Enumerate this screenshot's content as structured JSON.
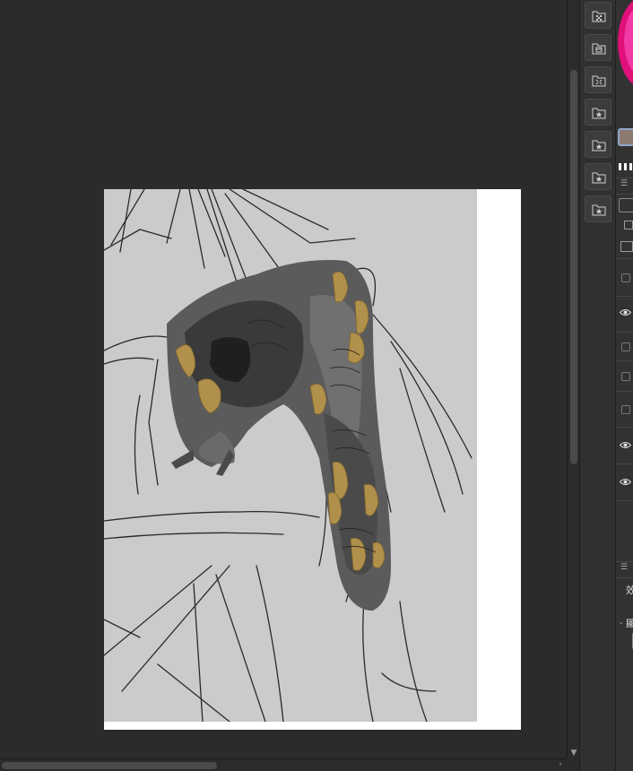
{
  "canvas": {
    "background": "#2b2b2b",
    "paper_color": "#ffffff",
    "artwork_fill": "#cbcbcb",
    "accent_gold": "#b0904a"
  },
  "toolbar": {
    "buttons": [
      {
        "icon": "folder-grid-icon"
      },
      {
        "icon": "folder-layout-icon"
      },
      {
        "icon": "folder-resize-icon"
      },
      {
        "icon": "folder-star-icon"
      },
      {
        "icon": "folder-star-icon"
      },
      {
        "icon": "folder-star-icon"
      },
      {
        "icon": "folder-star-icon"
      }
    ]
  },
  "right_panel": {
    "palette_label": "效",
    "display_label": "顯",
    "accent_color": "#e0107a",
    "swatch_color": "#8a7a70"
  }
}
